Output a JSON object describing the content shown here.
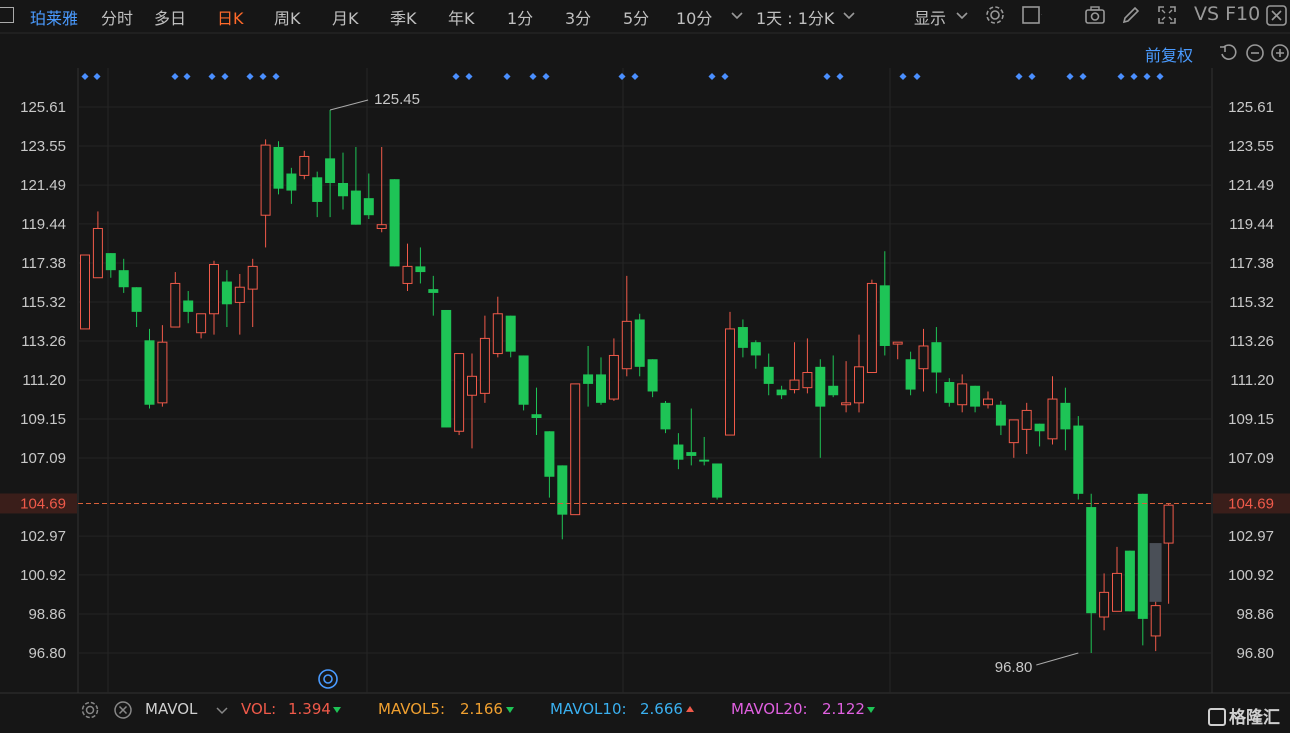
{
  "toolbar": {
    "stock_name": "珀莱雅",
    "tabs": [
      "分时",
      "多日",
      "日K",
      "周K",
      "月K",
      "季K",
      "年K",
      "1分",
      "3分",
      "5分",
      "10分"
    ],
    "active_tab": "日K",
    "more_chevron": "chevron-down-icon",
    "period_select": "1天 : 1分K",
    "display_label": "显示",
    "right_text": "VS F10"
  },
  "restore_label": "前复权",
  "price_axis": {
    "labels": [
      "125.61",
      "123.55",
      "121.49",
      "119.44",
      "117.38",
      "115.32",
      "113.26",
      "111.20",
      "109.15",
      "107.09",
      "102.97",
      "100.92",
      "98.86",
      "96.80"
    ],
    "current_price": "104.69"
  },
  "annotations": {
    "high": "125.45",
    "low": "96.80"
  },
  "volume_bar": {
    "indicator_name": "MAVOL",
    "vol_label": "VOL:",
    "vol_value": "1.394",
    "mavol5_label": "MAVOL5:",
    "mavol5_value": "2.166",
    "mavol10_label": "MAVOL10:",
    "mavol10_value": "2.666",
    "mavol20_label": "MAVOL20:",
    "mavol20_value": "2.122"
  },
  "watermark": "格隆汇",
  "colors": {
    "up": "#f05a4a",
    "down": "#1ec456",
    "accent": "#ff6a2a",
    "link": "#4a9bff",
    "mavol5": "#f0a030",
    "mavol10": "#3ab0f0",
    "mavol20": "#e060e0"
  },
  "chart_data": {
    "type": "candlestick",
    "ylim": [
      96.8,
      125.61
    ],
    "candles": [
      {
        "o": 113.9,
        "c": 117.8,
        "h": 117.8,
        "l": 113.9
      },
      {
        "o": 116.6,
        "c": 119.2,
        "h": 120.1,
        "l": 116.6
      },
      {
        "o": 117.9,
        "c": 117.0,
        "h": 117.9,
        "l": 116.6
      },
      {
        "o": 117.0,
        "c": 116.1,
        "h": 117.6,
        "l": 115.8
      },
      {
        "o": 116.1,
        "c": 114.8,
        "h": 116.1,
        "l": 114.0
      },
      {
        "o": 113.3,
        "c": 109.9,
        "h": 113.9,
        "l": 109.7
      },
      {
        "o": 110.0,
        "c": 113.2,
        "h": 114.1,
        "l": 109.8
      },
      {
        "o": 114.0,
        "c": 116.3,
        "h": 116.9,
        "l": 114.0
      },
      {
        "o": 115.4,
        "c": 114.8,
        "h": 115.9,
        "l": 114.2
      },
      {
        "o": 113.7,
        "c": 114.7,
        "h": 114.7,
        "l": 113.4
      },
      {
        "o": 114.7,
        "c": 117.3,
        "h": 117.5,
        "l": 113.6
      },
      {
        "o": 116.4,
        "c": 115.2,
        "h": 117.0,
        "l": 114.0
      },
      {
        "o": 115.3,
        "c": 116.1,
        "h": 116.8,
        "l": 113.6
      },
      {
        "o": 116.0,
        "c": 117.2,
        "h": 117.6,
        "l": 114.0
      },
      {
        "o": 119.9,
        "c": 123.6,
        "h": 123.9,
        "l": 118.2
      },
      {
        "o": 123.5,
        "c": 121.3,
        "h": 123.8,
        "l": 121.0
      },
      {
        "o": 122.1,
        "c": 121.2,
        "h": 122.4,
        "l": 120.5
      },
      {
        "o": 122.0,
        "c": 123.0,
        "h": 123.3,
        "l": 121.8
      },
      {
        "o": 121.9,
        "c": 120.6,
        "h": 122.2,
        "l": 119.8
      },
      {
        "o": 122.9,
        "c": 121.6,
        "h": 125.45,
        "l": 119.8
      },
      {
        "o": 121.6,
        "c": 120.9,
        "h": 123.2,
        "l": 120.2
      },
      {
        "o": 121.2,
        "c": 119.4,
        "h": 123.5,
        "l": 119.4
      },
      {
        "o": 120.8,
        "c": 119.9,
        "h": 122.1,
        "l": 119.7
      },
      {
        "o": 119.2,
        "c": 119.4,
        "h": 123.5,
        "l": 119.0
      },
      {
        "o": 121.8,
        "c": 117.2,
        "h": 121.8,
        "l": 117.2
      },
      {
        "o": 116.3,
        "c": 117.2,
        "h": 118.4,
        "l": 115.9
      },
      {
        "o": 117.2,
        "c": 116.9,
        "h": 118.2,
        "l": 116.3
      },
      {
        "o": 116.0,
        "c": 115.8,
        "h": 116.7,
        "l": 114.6
      },
      {
        "o": 114.9,
        "c": 108.7,
        "h": 114.9,
        "l": 108.7
      },
      {
        "o": 108.5,
        "c": 112.6,
        "h": 112.6,
        "l": 108.3
      },
      {
        "o": 110.4,
        "c": 111.4,
        "h": 112.6,
        "l": 107.6
      },
      {
        "o": 110.5,
        "c": 113.4,
        "h": 114.6,
        "l": 110.0
      },
      {
        "o": 112.6,
        "c": 114.7,
        "h": 115.6,
        "l": 112.4
      },
      {
        "o": 114.6,
        "c": 112.7,
        "h": 114.6,
        "l": 112.4
      },
      {
        "o": 112.5,
        "c": 109.9,
        "h": 112.5,
        "l": 109.6
      },
      {
        "o": 109.4,
        "c": 109.2,
        "h": 110.8,
        "l": 108.3
      },
      {
        "o": 108.5,
        "c": 106.1,
        "h": 108.5,
        "l": 105.0
      },
      {
        "o": 106.7,
        "c": 104.1,
        "h": 106.7,
        "l": 102.8
      },
      {
        "o": 104.1,
        "c": 111.0,
        "h": 111.0,
        "l": 104.1
      },
      {
        "o": 111.5,
        "c": 111.0,
        "h": 113.0,
        "l": 109.8
      },
      {
        "o": 111.5,
        "c": 110.0,
        "h": 112.4,
        "l": 109.9
      },
      {
        "o": 110.2,
        "c": 112.5,
        "h": 113.4,
        "l": 110.1
      },
      {
        "o": 111.8,
        "c": 114.3,
        "h": 116.7,
        "l": 111.4
      },
      {
        "o": 114.4,
        "c": 111.9,
        "h": 114.7,
        "l": 111.4
      },
      {
        "o": 112.3,
        "c": 110.6,
        "h": 112.3,
        "l": 110.3
      },
      {
        "o": 110.0,
        "c": 108.6,
        "h": 110.1,
        "l": 108.4
      },
      {
        "o": 107.8,
        "c": 107.0,
        "h": 108.4,
        "l": 106.5
      },
      {
        "o": 107.4,
        "c": 107.2,
        "h": 109.7,
        "l": 106.7
      },
      {
        "o": 107.0,
        "c": 106.9,
        "h": 108.2,
        "l": 106.7
      },
      {
        "o": 106.8,
        "c": 105.0,
        "h": 106.8,
        "l": 104.9
      },
      {
        "o": 108.3,
        "c": 113.9,
        "h": 114.8,
        "l": 108.3
      },
      {
        "o": 114.0,
        "c": 112.9,
        "h": 114.4,
        "l": 112.4
      },
      {
        "o": 113.2,
        "c": 112.5,
        "h": 113.3,
        "l": 111.8
      },
      {
        "o": 111.9,
        "c": 111.0,
        "h": 112.6,
        "l": 110.4
      },
      {
        "o": 110.7,
        "c": 110.4,
        "h": 110.9,
        "l": 110.2
      },
      {
        "o": 110.7,
        "c": 111.2,
        "h": 113.2,
        "l": 110.5
      },
      {
        "o": 110.8,
        "c": 111.6,
        "h": 113.4,
        "l": 110.5
      },
      {
        "o": 111.9,
        "c": 109.8,
        "h": 112.3,
        "l": 107.1
      },
      {
        "o": 110.9,
        "c": 110.4,
        "h": 112.5,
        "l": 110.3
      },
      {
        "o": 109.9,
        "c": 110.0,
        "h": 112.2,
        "l": 109.5
      },
      {
        "o": 110.0,
        "c": 111.9,
        "h": 113.6,
        "l": 109.5
      },
      {
        "o": 111.6,
        "c": 116.3,
        "h": 116.5,
        "l": 111.6
      },
      {
        "o": 116.2,
        "c": 113.0,
        "h": 118.0,
        "l": 112.5
      },
      {
        "o": 113.1,
        "c": 113.2,
        "h": 113.2,
        "l": 112.3
      },
      {
        "o": 112.3,
        "c": 110.7,
        "h": 112.7,
        "l": 110.4
      },
      {
        "o": 111.8,
        "c": 113.0,
        "h": 113.9,
        "l": 110.6
      },
      {
        "o": 113.2,
        "c": 111.6,
        "h": 114.0,
        "l": 110.5
      },
      {
        "o": 111.1,
        "c": 110.0,
        "h": 111.3,
        "l": 109.8
      },
      {
        "o": 109.9,
        "c": 111.0,
        "h": 111.5,
        "l": 109.5
      },
      {
        "o": 110.9,
        "c": 109.8,
        "h": 110.9,
        "l": 109.5
      },
      {
        "o": 109.9,
        "c": 110.2,
        "h": 110.6,
        "l": 109.7
      },
      {
        "o": 109.9,
        "c": 108.8,
        "h": 110.1,
        "l": 108.3
      },
      {
        "o": 107.9,
        "c": 109.1,
        "h": 109.1,
        "l": 107.1
      },
      {
        "o": 108.6,
        "c": 109.6,
        "h": 110.0,
        "l": 107.3
      },
      {
        "o": 108.9,
        "c": 108.5,
        "h": 108.9,
        "l": 107.7
      },
      {
        "o": 108.1,
        "c": 110.2,
        "h": 111.4,
        "l": 107.8
      },
      {
        "o": 110.0,
        "c": 108.6,
        "h": 110.8,
        "l": 107.5
      },
      {
        "o": 108.8,
        "c": 105.2,
        "h": 109.3,
        "l": 104.9
      },
      {
        "o": 104.5,
        "c": 98.9,
        "h": 105.2,
        "l": 96.8
      },
      {
        "o": 98.7,
        "c": 100.0,
        "h": 101.0,
        "l": 98.0
      },
      {
        "o": 99.0,
        "c": 101.0,
        "h": 102.4,
        "l": 99.0
      },
      {
        "o": 102.2,
        "c": 99.0,
        "h": 102.2,
        "l": 99.0
      },
      {
        "o": 105.2,
        "c": 98.6,
        "h": 105.2,
        "l": 97.2
      },
      {
        "o": 97.7,
        "c": 99.3,
        "h": 102.2,
        "l": 96.9
      },
      {
        "o": 102.6,
        "c": 104.6,
        "h": 104.7,
        "l": 99.4
      }
    ]
  }
}
